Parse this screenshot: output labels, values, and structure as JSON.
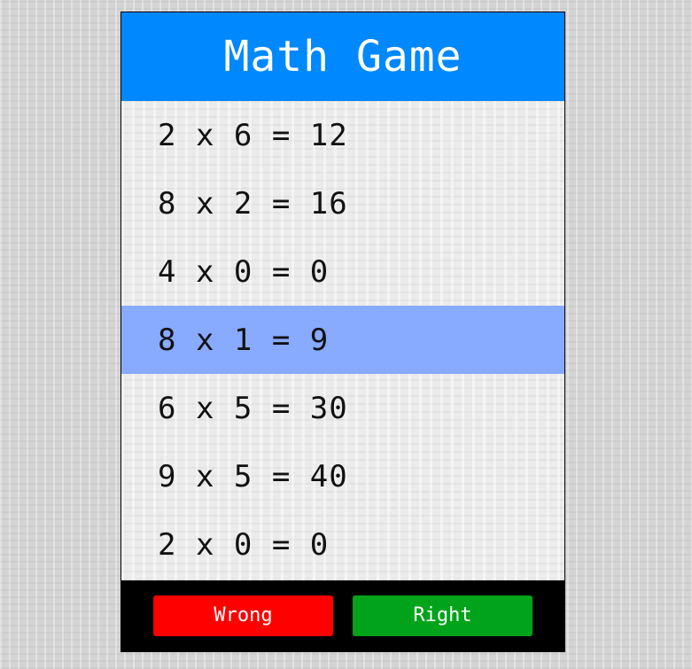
{
  "header": {
    "title": "Math Game"
  },
  "problems": [
    {
      "text": "2 x 6 = 12",
      "selected": false
    },
    {
      "text": "8 x 2 = 16",
      "selected": false
    },
    {
      "text": "4 x 0 = 0",
      "selected": false
    },
    {
      "text": "8 x 1 = 9",
      "selected": true
    },
    {
      "text": "6 x 5 = 30",
      "selected": false
    },
    {
      "text": "9 x 5 = 40",
      "selected": false
    },
    {
      "text": "2 x 0 = 0",
      "selected": false
    }
  ],
  "buttons": {
    "wrong_label": "Wrong",
    "right_label": "Right"
  },
  "colors": {
    "header": "#0088ff",
    "selected_row": "#88aaff",
    "wrong": "#ff0000",
    "right": "#00a31a",
    "footer": "#000000"
  }
}
